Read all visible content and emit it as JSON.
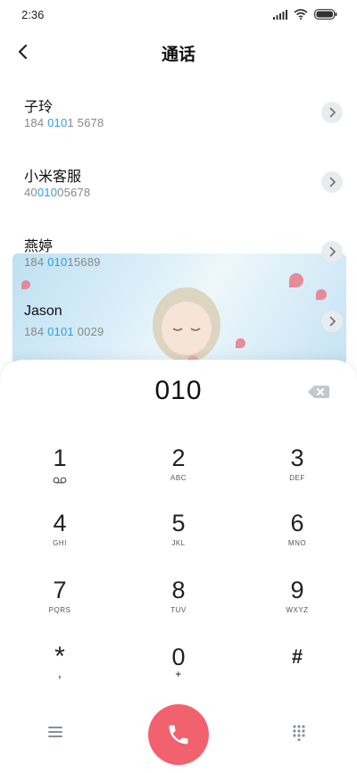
{
  "status_bar": {
    "time": "2:36"
  },
  "header": {
    "title": "通话"
  },
  "contacts": [
    {
      "name": "子玲",
      "number_parts": [
        "184 ",
        "010",
        "1 5678"
      ]
    },
    {
      "name": "小米客服",
      "number_parts": [
        "40",
        "010",
        "05678"
      ]
    },
    {
      "name": "燕婷",
      "number_parts": [
        "184 ",
        "010",
        "15689"
      ]
    },
    {
      "name": "Jason",
      "number_parts": [
        "184 ",
        "0101",
        " 0029"
      ]
    }
  ],
  "dialpad": {
    "entered": "010",
    "keys": [
      {
        "digit": "1",
        "letters": ""
      },
      {
        "digit": "2",
        "letters": "ABC"
      },
      {
        "digit": "3",
        "letters": "DEF"
      },
      {
        "digit": "4",
        "letters": "GHI"
      },
      {
        "digit": "5",
        "letters": "JKL"
      },
      {
        "digit": "6",
        "letters": "MNO"
      },
      {
        "digit": "7",
        "letters": "PQRS"
      },
      {
        "digit": "8",
        "letters": "TUV"
      },
      {
        "digit": "9",
        "letters": "WXYZ"
      },
      {
        "digit": "*",
        "letters": ","
      },
      {
        "digit": "0",
        "letters": "+"
      },
      {
        "digit": "#",
        "letters": ""
      }
    ]
  },
  "icons": {
    "back": "back-arrow-icon",
    "backspace": "backspace-icon",
    "voicemail": "voicemail-icon",
    "menu": "menu-icon",
    "call": "phone-icon",
    "keypad": "keypad-icon"
  },
  "colors": {
    "call": "#f2616e",
    "highlight": "#2aa0e4"
  }
}
